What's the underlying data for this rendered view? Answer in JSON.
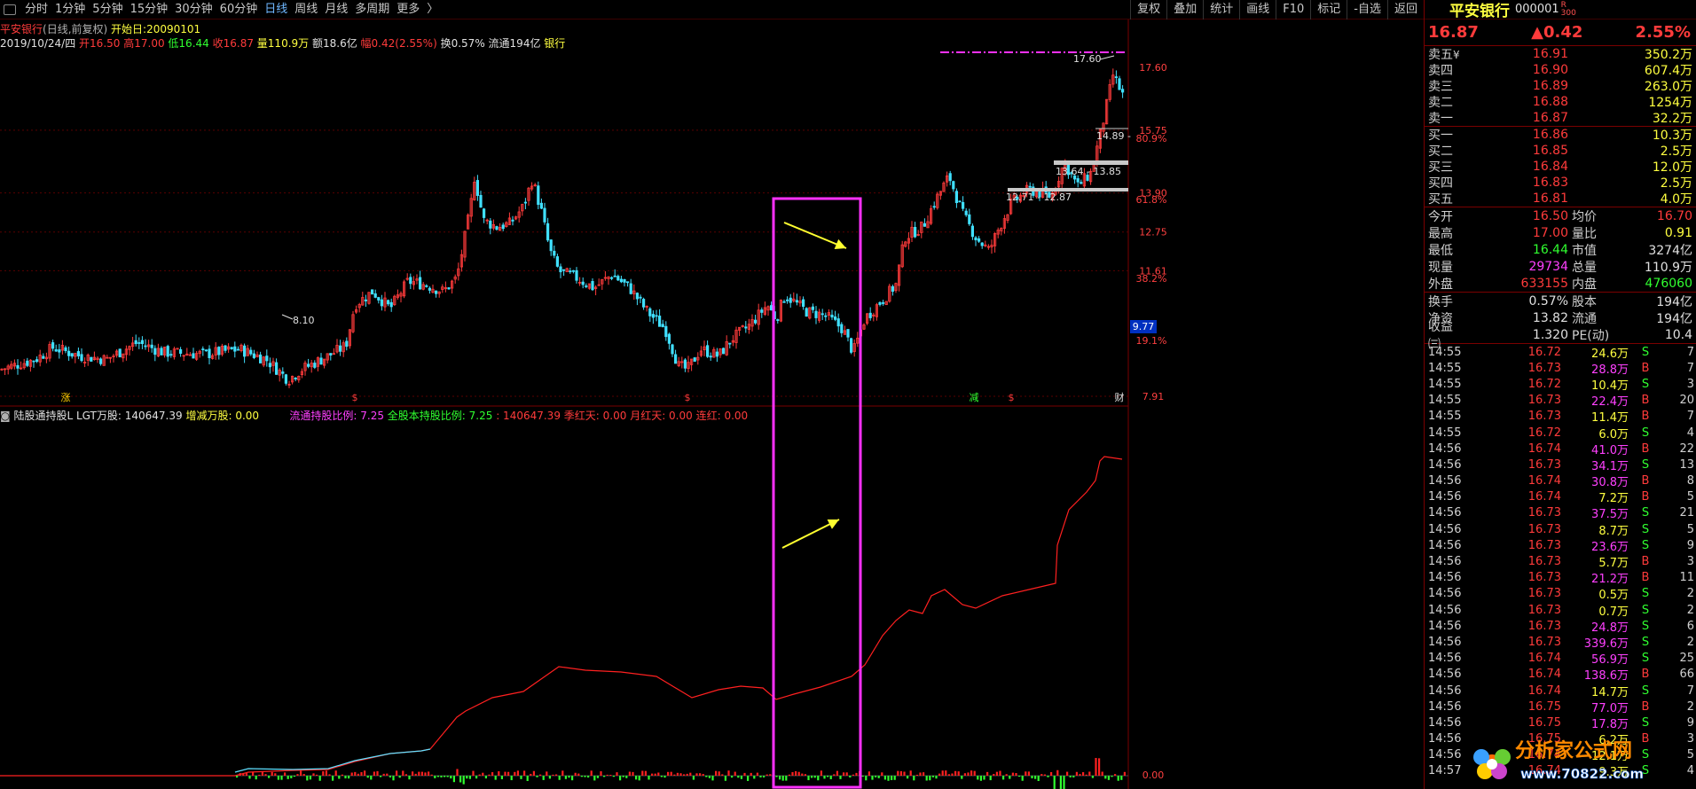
{
  "toolbar": {
    "periods": [
      "分时",
      "1分钟",
      "5分钟",
      "15分钟",
      "30分钟",
      "60分钟",
      "日线",
      "周线",
      "月线",
      "多周期",
      "更多"
    ],
    "more_arrow": "〉",
    "active_index": 6,
    "right_buttons": [
      "复权",
      "叠加",
      "统计",
      "画线",
      "F10",
      "标记",
      "-自选",
      "返回"
    ]
  },
  "info": {
    "stock_title": "平安银行",
    "title_suffix": "(日线,前复权)",
    "start_label": "开始日:20090101",
    "date": "2019/10/24/四",
    "open": "开16.50",
    "high": "高17.00",
    "low": "低16.44",
    "close": "收16.87",
    "volume": "量110.9万",
    "amount": "额18.6亿",
    "change": "幅0.42(2.55%)",
    "turnover": "换0.57%",
    "float_cap": "流通194亿",
    "sector": "银行"
  },
  "indicator": {
    "name": "陆股通持股L",
    "lgt": "LGT万股: 140647.39",
    "delta": "增减万股: 0.00",
    "float_ratio": "流通持股比例: 7.25",
    "total_ratio": "全股本持股比例: 7.25",
    "val": ": 140647.39",
    "season": "季红天: 0.00",
    "month": "月红天: 0.00",
    "streak": "连红: 0.00"
  },
  "price_axis": [
    "17.60",
    "15.75",
    "13.90",
    "12.75",
    "11.61",
    "9.77",
    "7.91"
  ],
  "pct_axis": [
    "80.9%",
    "61.8%",
    "38.2%",
    "19.1%"
  ],
  "axis_vol_zero": "0.00",
  "cursor_price": "9.77",
  "fib_labels": [
    "17.60",
    "14.89 -",
    "13.64 - 13.85",
    "12.71 - 12.87"
  ],
  "low_label": "8.10",
  "event_marks": [
    "涨",
    "$",
    "$",
    "减",
    "$",
    "财"
  ],
  "panel": {
    "name": "平安银行",
    "code": "000001",
    "badge_r": "R",
    "badge_num": "300",
    "price": "16.87",
    "change": "▲0.42",
    "pct": "2.55%",
    "sell": [
      {
        "label": "卖五",
        "mark": "¥",
        "price": "16.91",
        "vol": "350.2万"
      },
      {
        "label": "卖四",
        "mark": "",
        "price": "16.90",
        "vol": "607.4万"
      },
      {
        "label": "卖三",
        "mark": "",
        "price": "16.89",
        "vol": "263.0万"
      },
      {
        "label": "卖二",
        "mark": "",
        "price": "16.88",
        "vol": "1254万"
      },
      {
        "label": "卖一",
        "mark": "",
        "price": "16.87",
        "vol": "32.2万"
      }
    ],
    "buy": [
      {
        "label": "买一",
        "price": "16.86",
        "vol": "10.3万"
      },
      {
        "label": "买二",
        "price": "16.85",
        "vol": "2.5万"
      },
      {
        "label": "买三",
        "price": "16.84",
        "vol": "12.0万"
      },
      {
        "label": "买四",
        "price": "16.83",
        "vol": "2.5万"
      },
      {
        "label": "买五",
        "price": "16.81",
        "vol": "4.0万"
      }
    ],
    "stats1": [
      {
        "l1": "今开",
        "v1": "16.50",
        "c1": "red",
        "l2": "均价",
        "v2": "16.70",
        "c2": "red"
      },
      {
        "l1": "最高",
        "v1": "17.00",
        "c1": "red",
        "l2": "量比",
        "v2": "0.91",
        "c2": "yellow"
      },
      {
        "l1": "最低",
        "v1": "16.44",
        "c1": "green",
        "l2": "市值",
        "v2": "3274亿",
        "c2": "white"
      },
      {
        "l1": "现量",
        "v1": "29734",
        "c1": "mag",
        "l2": "总量",
        "v2": "110.9万",
        "c2": "white"
      },
      {
        "l1": "外盘",
        "v1": "633155",
        "c1": "red",
        "l2": "内盘",
        "v2": "476060",
        "c2": "green"
      }
    ],
    "stats2": [
      {
        "l1": "换手",
        "v1": "0.57%",
        "c1": "white",
        "l2": "股本",
        "v2": "194亿",
        "c2": "white"
      },
      {
        "l1": "净资",
        "v1": "13.82",
        "c1": "white",
        "l2": "流通",
        "v2": "194亿",
        "c2": "white"
      },
      {
        "l1": "收益㈢",
        "v1": "1.320",
        "c1": "white",
        "l2": "PE(动)",
        "v2": "10.4",
        "c2": "white"
      }
    ],
    "ticks": [
      {
        "t": "14:55",
        "p": "16.72",
        "v": "24.6万",
        "vc": "yellow",
        "d": "S",
        "n": "7"
      },
      {
        "t": "14:55",
        "p": "16.73",
        "v": "28.8万",
        "vc": "mag",
        "d": "B",
        "n": "7"
      },
      {
        "t": "14:55",
        "p": "16.72",
        "v": "10.4万",
        "vc": "yellow",
        "d": "S",
        "n": "3"
      },
      {
        "t": "14:55",
        "p": "16.73",
        "v": "22.4万",
        "vc": "mag",
        "d": "B",
        "n": "20"
      },
      {
        "t": "14:55",
        "p": "16.73",
        "v": "11.4万",
        "vc": "yellow",
        "d": "B",
        "n": "7"
      },
      {
        "t": "14:55",
        "p": "16.72",
        "v": "6.0万",
        "vc": "yellow",
        "d": "S",
        "n": "4"
      },
      {
        "t": "14:56",
        "p": "16.74",
        "v": "41.0万",
        "vc": "mag",
        "d": "B",
        "n": "22"
      },
      {
        "t": "14:56",
        "p": "16.73",
        "v": "34.1万",
        "vc": "mag",
        "d": "S",
        "n": "13"
      },
      {
        "t": "14:56",
        "p": "16.74",
        "v": "30.8万",
        "vc": "mag",
        "d": "B",
        "n": "8"
      },
      {
        "t": "14:56",
        "p": "16.74",
        "v": "7.2万",
        "vc": "yellow",
        "d": "B",
        "n": "5"
      },
      {
        "t": "14:56",
        "p": "16.73",
        "v": "37.5万",
        "vc": "mag",
        "d": "S",
        "n": "21"
      },
      {
        "t": "14:56",
        "p": "16.73",
        "v": "8.7万",
        "vc": "yellow",
        "d": "S",
        "n": "5"
      },
      {
        "t": "14:56",
        "p": "16.73",
        "v": "23.6万",
        "vc": "mag",
        "d": "S",
        "n": "9"
      },
      {
        "t": "14:56",
        "p": "16.73",
        "v": "5.7万",
        "vc": "yellow",
        "d": "B",
        "n": "3"
      },
      {
        "t": "14:56",
        "p": "16.73",
        "v": "21.2万",
        "vc": "mag",
        "d": "B",
        "n": "11"
      },
      {
        "t": "14:56",
        "p": "16.73",
        "v": "0.5万",
        "vc": "yellow",
        "d": "S",
        "n": "2"
      },
      {
        "t": "14:56",
        "p": "16.73",
        "v": "0.7万",
        "vc": "yellow",
        "d": "S",
        "n": "2"
      },
      {
        "t": "14:56",
        "p": "16.73",
        "v": "24.8万",
        "vc": "mag",
        "d": "S",
        "n": "6"
      },
      {
        "t": "14:56",
        "p": "16.73",
        "v": "339.6万",
        "vc": "mag",
        "d": "S",
        "n": "2"
      },
      {
        "t": "14:56",
        "p": "16.74",
        "v": "56.9万",
        "vc": "mag",
        "d": "S",
        "n": "25"
      },
      {
        "t": "14:56",
        "p": "16.74",
        "v": "138.6万",
        "vc": "mag",
        "d": "B",
        "n": "66"
      },
      {
        "t": "14:56",
        "p": "16.74",
        "v": "14.7万",
        "vc": "yellow",
        "d": "S",
        "n": "7"
      },
      {
        "t": "14:56",
        "p": "16.75",
        "v": "77.0万",
        "vc": "mag",
        "d": "B",
        "n": "2"
      },
      {
        "t": "14:56",
        "p": "16.75",
        "v": "17.8万",
        "vc": "mag",
        "d": "S",
        "n": "9"
      },
      {
        "t": "14:56",
        "p": "16.75",
        "v": "6.2万",
        "vc": "yellow",
        "d": "B",
        "n": "3"
      },
      {
        "t": "14:56",
        "p": "16.74",
        "v": "12.1万",
        "vc": "yellow",
        "d": "S",
        "n": "5"
      },
      {
        "t": "14:57",
        "p": "16.74",
        "v": "9.3万",
        "vc": "yellow",
        "d": "S",
        "n": "4"
      }
    ]
  },
  "watermark": {
    "title": "分析家公式网",
    "url": "www.70822.com"
  },
  "colors": {
    "up": "#ff3b3b",
    "down": "#40e0ff",
    "grid": "#5a0000",
    "highlight": "#ff30ff",
    "arrow": "#ffff30"
  }
}
